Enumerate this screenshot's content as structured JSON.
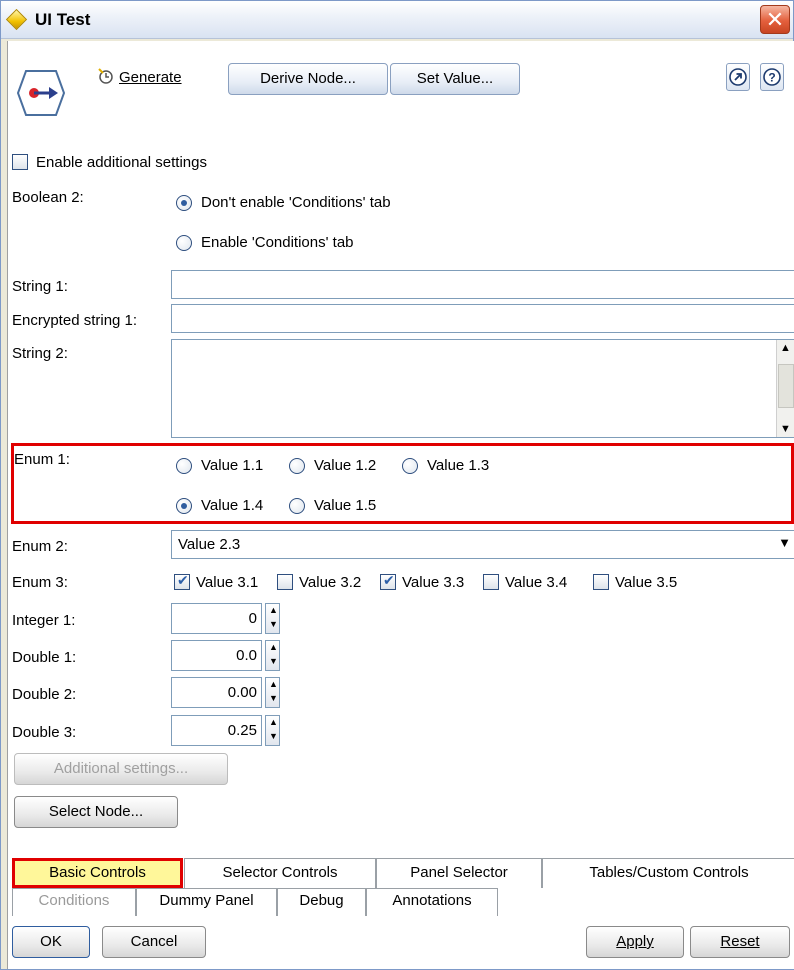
{
  "window": {
    "title": "UI Test",
    "close_glyph": "✕"
  },
  "toolbar": {
    "generate_prefix": "",
    "generate_label": "Generate",
    "derive_node": "Derive Node...",
    "set_value": "Set Value...",
    "icons": [
      "node-icon",
      "generate-icon",
      "expand-arrow-icon",
      "help-icon"
    ]
  },
  "form": {
    "enable_additional": "Enable additional settings",
    "boolean2": {
      "label": "Boolean 2:",
      "options": [
        "Don't enable 'Conditions' tab",
        "Enable 'Conditions' tab"
      ],
      "selected": 0
    },
    "string1_label": "String 1:",
    "string1_value": "",
    "encrypted1_label": "Encrypted string 1:",
    "encrypted1_value": "",
    "string2_label": "String 2:",
    "enum1": {
      "label": "Enum 1:",
      "options": [
        "Value 1.1",
        "Value 1.2",
        "Value 1.3",
        "Value 1.4",
        "Value 1.5"
      ],
      "selected": 3
    },
    "enum2": {
      "label": "Enum 2:",
      "value": "Value 2.3"
    },
    "enum3": {
      "label": "Enum 3:",
      "options": [
        "Value 3.1",
        "Value 3.2",
        "Value 3.3",
        "Value 3.4",
        "Value 3.5"
      ],
      "checked": [
        true,
        false,
        true,
        false,
        false
      ]
    },
    "integer1": {
      "label": "Integer 1:",
      "value": "0"
    },
    "double1": {
      "label": "Double 1:",
      "value": "0.0"
    },
    "double2": {
      "label": "Double 2:",
      "value": "0.00"
    },
    "double3": {
      "label": "Double 3:",
      "value": "0.25"
    },
    "additional_settings_btn": "Additional settings...",
    "select_node_btn": "Select Node..."
  },
  "tabs_row1": [
    "Basic Controls",
    "Selector Controls",
    "Panel Selector",
    "Tables/Custom Controls"
  ],
  "tabs_row2": [
    "Conditions",
    "Dummy Panel",
    "Debug",
    "Annotations"
  ],
  "footer": {
    "ok": "OK",
    "cancel": "Cancel",
    "apply": "Apply",
    "reset": "Reset"
  },
  "colors": {
    "highlight": "#e00000",
    "active_tab": "#fff79a",
    "title_icon": "#f2c200"
  }
}
